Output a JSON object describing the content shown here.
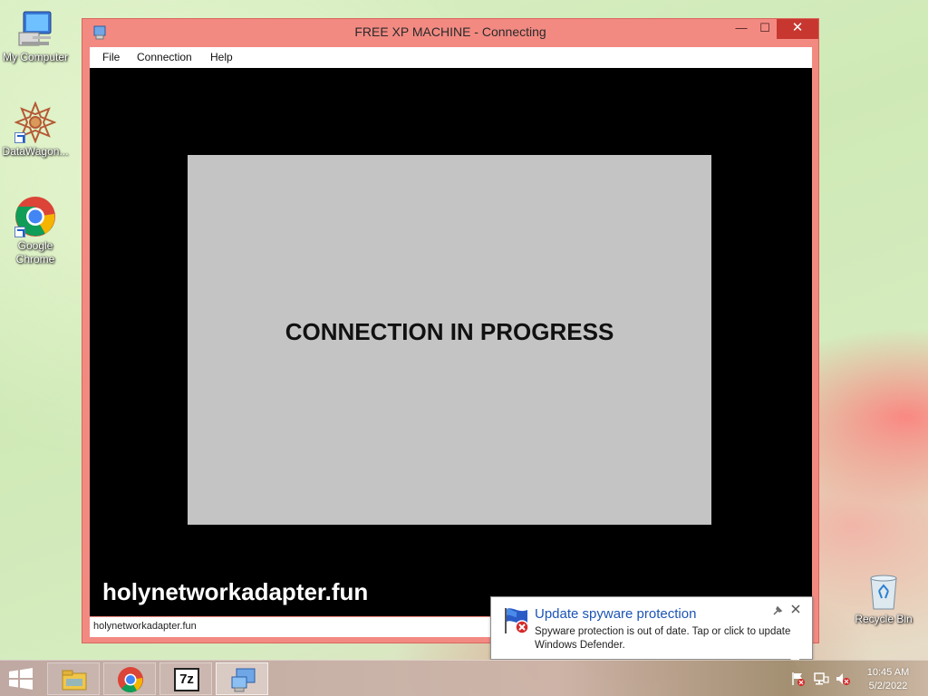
{
  "desktop": {
    "icons": [
      {
        "label": "My Computer"
      },
      {
        "label": "DataWagon..."
      },
      {
        "label": "Google Chrome"
      },
      {
        "label": "Recycle Bin"
      }
    ]
  },
  "window": {
    "title": "FREE XP MACHINE - Connecting",
    "controls": {
      "minimize": "—",
      "maximize": "☐",
      "close": "✕"
    },
    "menu": [
      "File",
      "Connection",
      "Help"
    ],
    "panel_text": "CONNECTION IN PROGRESS",
    "watermark": "holynetworkadapter.fun",
    "status": "holynetworkadapter.fun"
  },
  "notification": {
    "title": "Update spyware protection",
    "body": "Spyware protection is out of date. Tap or click to update Windows Defender.",
    "icon": "windows-defender-error-icon"
  },
  "taskbar": {
    "apps": [
      {
        "name": "file-explorer"
      },
      {
        "name": "google-chrome"
      },
      {
        "name": "7-zip",
        "label": "7z"
      },
      {
        "name": "remote-connection",
        "active": true
      }
    ],
    "clock": {
      "time": "10:45 AM",
      "date": "5/2/2022"
    }
  },
  "colors": {
    "window_frame": "#f28a82",
    "close_button": "#c7372f",
    "panel": "#c4c4c4",
    "notification_title": "#1c55b5"
  }
}
